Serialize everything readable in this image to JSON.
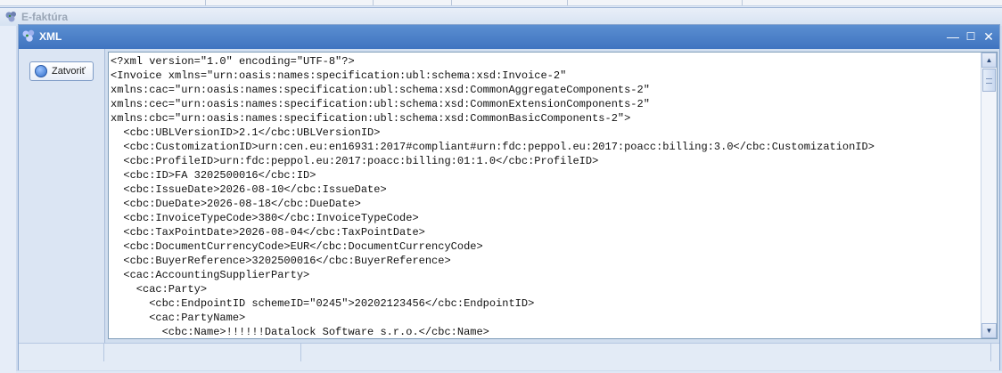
{
  "background_window": {
    "title": "E-faktúra"
  },
  "dialog": {
    "title": "XML",
    "controls": {
      "minimize": "—",
      "maximize": "☐",
      "close": "✕"
    },
    "close_button_label": "Zatvoriť"
  },
  "editor": {
    "lines": [
      "<?xml version=\"1.0\" encoding=\"UTF-8\"?>",
      "<Invoice xmlns=\"urn:oasis:names:specification:ubl:schema:xsd:Invoice-2\"",
      "xmlns:cac=\"urn:oasis:names:specification:ubl:schema:xsd:CommonAggregateComponents-2\"",
      "xmlns:cec=\"urn:oasis:names:specification:ubl:schema:xsd:CommonExtensionComponents-2\"",
      "xmlns:cbc=\"urn:oasis:names:specification:ubl:schema:xsd:CommonBasicComponents-2\">",
      "  <cbc:UBLVersionID>2.1</cbc:UBLVersionID>",
      "  <cbc:CustomizationID>urn:cen.eu:en16931:2017#compliant#urn:fdc:peppol.eu:2017:poacc:billing:3.0</cbc:CustomizationID>",
      "  <cbc:ProfileID>urn:fdc:peppol.eu:2017:poacc:billing:01:1.0</cbc:ProfileID>",
      "  <cbc:ID>FA 3202500016</cbc:ID>",
      "  <cbc:IssueDate>2026-08-10</cbc:IssueDate>",
      "  <cbc:DueDate>2026-08-18</cbc:DueDate>",
      "  <cbc:InvoiceTypeCode>380</cbc:InvoiceTypeCode>",
      "  <cbc:TaxPointDate>2026-08-04</cbc:TaxPointDate>",
      "  <cbc:DocumentCurrencyCode>EUR</cbc:DocumentCurrencyCode>",
      "  <cbc:BuyerReference>3202500016</cbc:BuyerReference>",
      "  <cac:AccountingSupplierParty>",
      "    <cac:Party>",
      "      <cbc:EndpointID schemeID=\"0245\">20202123456</cbc:EndpointID>",
      "      <cac:PartyName>",
      "        <cbc:Name>!!!!!!Datalock Software s.r.o.</cbc:Name>"
    ]
  }
}
